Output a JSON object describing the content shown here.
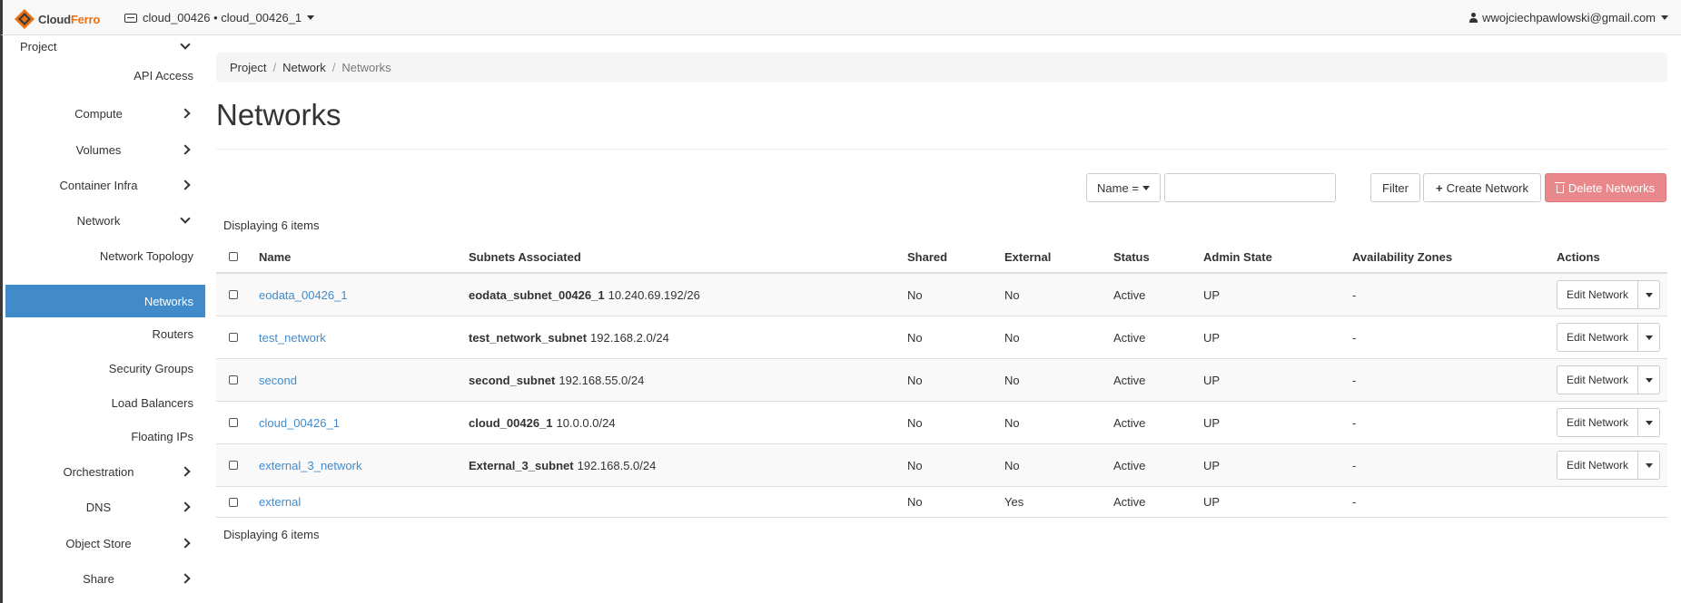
{
  "brand": {
    "logo_part1": "Cloud",
    "logo_part2": "Ferro",
    "accent": "#ea7012"
  },
  "topbar": {
    "project": "cloud_00426 • cloud_00426_1",
    "user": "wwojciechpawlowski@gmail.com"
  },
  "sidebar": {
    "project": "Project",
    "api_access": "API Access",
    "compute": "Compute",
    "volumes": "Volumes",
    "container_infra": "Container Infra",
    "network": "Network",
    "network_topology": "Network Topology",
    "networks": "Networks",
    "routers": "Routers",
    "security_groups": "Security Groups",
    "load_balancers": "Load Balancers",
    "floating_ips": "Floating IPs",
    "orchestration": "Orchestration",
    "dns": "DNS",
    "object_store": "Object Store",
    "share": "Share",
    "active_color": "#428bca"
  },
  "breadcrumb": {
    "project": "Project",
    "network": "Network",
    "current": "Networks",
    "separator": "/"
  },
  "page": {
    "title": "Networks"
  },
  "toolbar": {
    "filter_field": "Name =",
    "filter_value": "",
    "filter_button": "Filter",
    "create_button": "Create Network",
    "delete_button": "Delete Networks"
  },
  "table": {
    "count_top": "Displaying 6 items",
    "count_bottom": "Displaying 6 items",
    "headers": {
      "name": "Name",
      "subnets": "Subnets Associated",
      "shared": "Shared",
      "external": "External",
      "status": "Status",
      "admin_state": "Admin State",
      "zones": "Availability Zones",
      "actions": "Actions"
    },
    "rows": [
      {
        "name": "eodata_00426_1",
        "subnet_name": "eodata_subnet_00426_1",
        "subnet_cidr": "10.240.69.192/26",
        "shared": "No",
        "external": "No",
        "status": "Active",
        "admin_state": "UP",
        "zones": "-",
        "action": "Edit Network"
      },
      {
        "name": "test_network",
        "subnet_name": "test_network_subnet",
        "subnet_cidr": "192.168.2.0/24",
        "shared": "No",
        "external": "No",
        "status": "Active",
        "admin_state": "UP",
        "zones": "-",
        "action": "Edit Network"
      },
      {
        "name": "second",
        "subnet_name": "second_subnet",
        "subnet_cidr": "192.168.55.0/24",
        "shared": "No",
        "external": "No",
        "status": "Active",
        "admin_state": "UP",
        "zones": "-",
        "action": "Edit Network"
      },
      {
        "name": "cloud_00426_1",
        "subnet_name": "cloud_00426_1",
        "subnet_cidr": "10.0.0.0/24",
        "shared": "No",
        "external": "No",
        "status": "Active",
        "admin_state": "UP",
        "zones": "-",
        "action": "Edit Network"
      },
      {
        "name": "external_3_network",
        "subnet_name": "External_3_subnet",
        "subnet_cidr": "192.168.5.0/24",
        "shared": "No",
        "external": "No",
        "status": "Active",
        "admin_state": "UP",
        "zones": "-",
        "action": "Edit Network"
      },
      {
        "name": "external",
        "subnet_name": "",
        "subnet_cidr": "",
        "shared": "No",
        "external": "Yes",
        "status": "Active",
        "admin_state": "UP",
        "zones": "-",
        "action": ""
      }
    ]
  }
}
